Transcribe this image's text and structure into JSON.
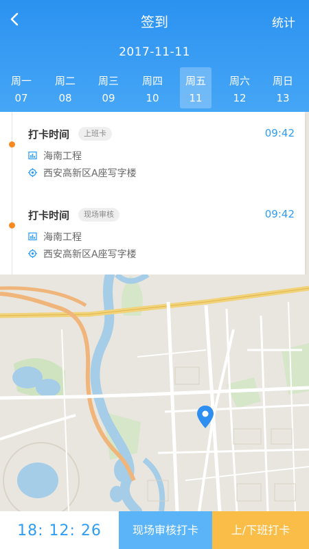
{
  "header": {
    "title": "签到",
    "stats_label": "统计",
    "date": "2017-11-11",
    "back_icon": "chevron-left-icon"
  },
  "week": [
    {
      "name": "周一",
      "num": "07",
      "active": false
    },
    {
      "name": "周二",
      "num": "08",
      "active": false
    },
    {
      "name": "周三",
      "num": "09",
      "active": false
    },
    {
      "name": "周四",
      "num": "10",
      "active": false
    },
    {
      "name": "周五",
      "num": "11",
      "active": true
    },
    {
      "name": "周六",
      "num": "12",
      "active": false
    },
    {
      "name": "周日",
      "num": "13",
      "active": false
    }
  ],
  "records": [
    {
      "title": "打卡时间",
      "tag": "上班卡",
      "time": "09:42",
      "project": "海南工程",
      "address": "西安高新区A座写字楼"
    },
    {
      "title": "打卡时间",
      "tag": "现场审核",
      "time": "09:42",
      "project": "海南工程",
      "address": "西安高新区A座写字楼"
    }
  ],
  "bottom": {
    "clock": "18: 12: 26",
    "site_button": "现场审核打卡",
    "onoff_button": "上/下班打卡"
  },
  "colors": {
    "header": "#2b92f0",
    "accent_blue": "#2f9df4",
    "timeline_dot": "#f7891f",
    "site_button": "#5ab4f7",
    "onoff_button": "#f9bd48"
  }
}
